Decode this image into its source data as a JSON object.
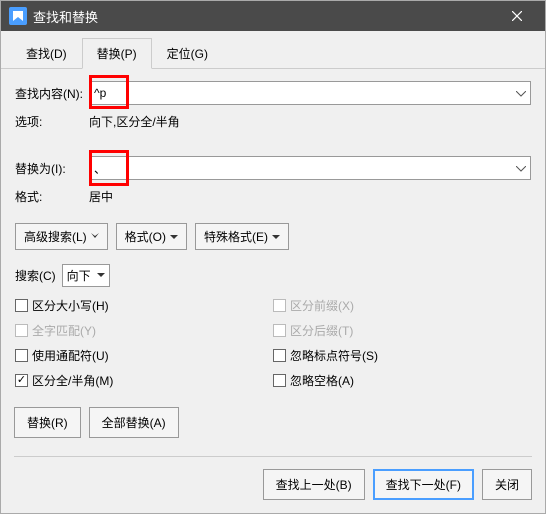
{
  "titlebar": {
    "title": "查找和替换"
  },
  "tabs": {
    "find": "查找(D)",
    "replace": "替换(P)",
    "goto": "定位(G)"
  },
  "find": {
    "label": "查找内容(N):",
    "value": "^p"
  },
  "options": {
    "label": "选项:",
    "value": "向下,区分全/半角"
  },
  "replace": {
    "label": "替换为(I):",
    "value": "、"
  },
  "format": {
    "label": "格式:",
    "value": "居中"
  },
  "buttons": {
    "advanced": "高级搜索(L)",
    "format": "格式(O)",
    "special": "特殊格式(E)"
  },
  "search": {
    "label": "搜索(C)",
    "direction": "向下"
  },
  "checks": {
    "case": "区分大小写(H)",
    "whole": "全字匹配(Y)",
    "wildcard": "使用通配符(U)",
    "fullwidth": "区分全/半角(M)",
    "prefix": "区分前缀(X)",
    "suffix": "区分后缀(T)",
    "punct": "忽略标点符号(S)",
    "space": "忽略空格(A)"
  },
  "footer": {
    "replaceOne": "替换(R)",
    "replaceAll": "全部替换(A)",
    "findPrev": "查找上一处(B)",
    "findNext": "查找下一处(F)",
    "close": "关闭"
  }
}
